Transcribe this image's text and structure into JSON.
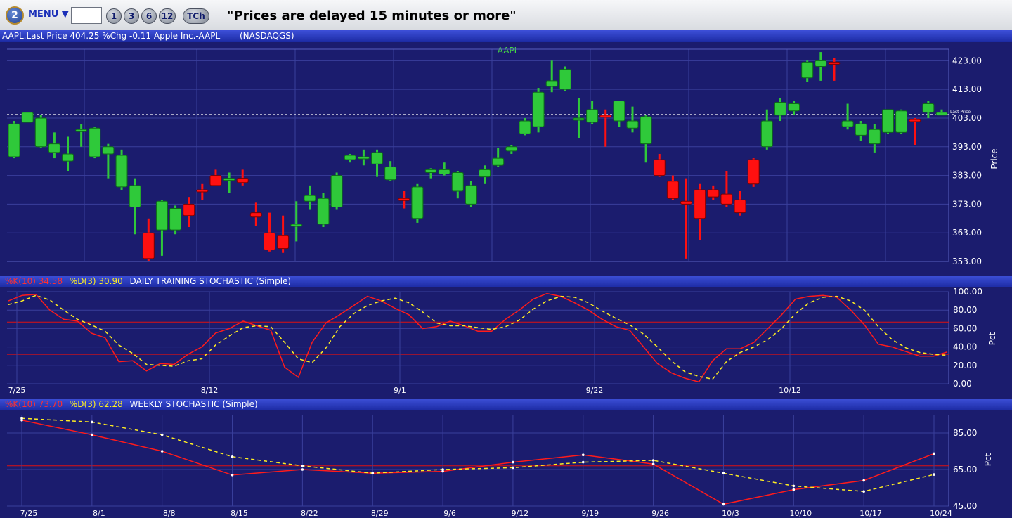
{
  "toolbar": {
    "menu_label": "MENU ▼",
    "symbol_value": "",
    "buttons": [
      "1",
      "3",
      "6",
      "12",
      "TCh"
    ],
    "notice": "\"Prices are delayed 15 minutes or more\""
  },
  "quote_bar": {
    "text": "AAPL.Last Price 404.25 %Chg -0.11  Apple Inc.-AAPL",
    "exchange": "(NASDAQGS)"
  },
  "colors": {
    "up": "#2fc93a",
    "down": "#ff1010",
    "k_line": "#ff1b1b",
    "d_line": "#ffee22",
    "grid": "#3a3f9c",
    "bg": "#1b1c6e"
  },
  "chart_data": [
    {
      "type": "candlestick",
      "title": "AAPL",
      "ylabel": "Price",
      "ylim": [
        353,
        427
      ],
      "yticks": [
        "423.00",
        "413.00",
        "403.00",
        "393.00",
        "383.00",
        "373.00",
        "363.00",
        "353.00"
      ],
      "last_price": 404.25,
      "last_label": "Last Price",
      "candles": [
        {
          "o": 389.5,
          "h": 402,
          "l": 389,
          "c": 401
        },
        {
          "o": 401.5,
          "h": 405,
          "l": 402,
          "c": 405
        },
        {
          "o": 393,
          "h": 404,
          "l": 392.5,
          "c": 403
        },
        {
          "o": 391,
          "h": 398,
          "l": 389,
          "c": 394
        },
        {
          "o": 388,
          "h": 396.5,
          "l": 384.5,
          "c": 390.5
        },
        {
          "o": 399,
          "h": 401,
          "l": 393,
          "c": 399
        },
        {
          "o": 389.5,
          "h": 400,
          "l": 389,
          "c": 399.5
        },
        {
          "o": 390.5,
          "h": 394,
          "l": 382,
          "c": 393
        },
        {
          "o": 379,
          "h": 392,
          "l": 378,
          "c": 390
        },
        {
          "o": 372,
          "h": 382,
          "l": 362.5,
          "c": 379.5
        },
        {
          "o": 363,
          "h": 368,
          "l": 353,
          "c": 354
        },
        {
          "o": 364,
          "h": 374.5,
          "l": 355,
          "c": 374
        },
        {
          "o": 364,
          "h": 372.5,
          "l": 362.5,
          "c": 371.5
        },
        {
          "o": 373,
          "h": 375.5,
          "l": 365,
          "c": 369
        },
        {
          "o": 378,
          "h": 380,
          "l": 374.5,
          "c": 377.5
        },
        {
          "o": 383,
          "h": 385,
          "l": 380,
          "c": 379.5
        },
        {
          "o": 382,
          "h": 384,
          "l": 377,
          "c": 382
        },
        {
          "o": 382,
          "h": 385,
          "l": 379.5,
          "c": 380.5
        },
        {
          "o": 370,
          "h": 373.5,
          "l": 365.5,
          "c": 368.5
        },
        {
          "o": 363,
          "h": 370,
          "l": 356.5,
          "c": 357
        },
        {
          "o": 362,
          "h": 369,
          "l": 356,
          "c": 357.5
        },
        {
          "o": 366,
          "h": 374,
          "l": 360,
          "c": 366
        },
        {
          "o": 374,
          "h": 379.5,
          "l": 371,
          "c": 376
        },
        {
          "o": 366,
          "h": 377,
          "l": 365,
          "c": 375
        },
        {
          "o": 372,
          "h": 384,
          "l": 371,
          "c": 383
        },
        {
          "o": 388.5,
          "h": 390.5,
          "l": 387.5,
          "c": 390
        },
        {
          "o": 389,
          "h": 392,
          "l": 386.5,
          "c": 389.5
        },
        {
          "o": 387,
          "h": 392,
          "l": 382.5,
          "c": 391
        },
        {
          "o": 381.5,
          "h": 388,
          "l": 381,
          "c": 386
        },
        {
          "o": 375,
          "h": 377.5,
          "l": 371.5,
          "c": 374.5
        },
        {
          "o": 368,
          "h": 380,
          "l": 366.5,
          "c": 379
        },
        {
          "o": 384,
          "h": 385.5,
          "l": 382,
          "c": 385
        },
        {
          "o": 383.5,
          "h": 387.5,
          "l": 383,
          "c": 385
        },
        {
          "o": 377.5,
          "h": 384.5,
          "l": 375,
          "c": 384
        },
        {
          "o": 373,
          "h": 381,
          "l": 372,
          "c": 379.5
        },
        {
          "o": 382.5,
          "h": 386.5,
          "l": 380,
          "c": 385
        },
        {
          "o": 386.5,
          "h": 392.5,
          "l": 386,
          "c": 389
        },
        {
          "o": 391.5,
          "h": 393.5,
          "l": 390.5,
          "c": 393
        },
        {
          "o": 397.5,
          "h": 403,
          "l": 397,
          "c": 402
        },
        {
          "o": 400,
          "h": 413.5,
          "l": 398,
          "c": 412
        },
        {
          "o": 414,
          "h": 423,
          "l": 412,
          "c": 416
        },
        {
          "o": 413,
          "h": 421,
          "l": 412.5,
          "c": 420
        },
        {
          "o": 403,
          "h": 410,
          "l": 396,
          "c": 403
        },
        {
          "o": 401.5,
          "h": 409,
          "l": 401,
          "c": 406
        },
        {
          "o": 404,
          "h": 406,
          "l": 393,
          "c": 403.5
        },
        {
          "o": 402,
          "h": 409,
          "l": 400,
          "c": 409
        },
        {
          "o": 399.5,
          "h": 407,
          "l": 398,
          "c": 402
        },
        {
          "o": 394,
          "h": 404,
          "l": 387.5,
          "c": 403.5
        },
        {
          "o": 388.5,
          "h": 390.5,
          "l": 382.5,
          "c": 383
        },
        {
          "o": 381,
          "h": 383,
          "l": 374.5,
          "c": 375
        },
        {
          "o": 374,
          "h": 382,
          "l": 354,
          "c": 373
        },
        {
          "o": 378,
          "h": 380,
          "l": 360.5,
          "c": 368
        },
        {
          "o": 378,
          "h": 379.5,
          "l": 374.5,
          "c": 375.5
        },
        {
          "o": 376.5,
          "h": 384.5,
          "l": 372,
          "c": 373
        },
        {
          "o": 374.5,
          "h": 377.5,
          "l": 369,
          "c": 370
        },
        {
          "o": 388.5,
          "h": 389,
          "l": 379,
          "c": 380
        },
        {
          "o": 393,
          "h": 406,
          "l": 392,
          "c": 402
        },
        {
          "o": 404,
          "h": 410,
          "l": 402,
          "c": 408.5
        },
        {
          "o": 405.5,
          "h": 409,
          "l": 404,
          "c": 408
        },
        {
          "o": 417,
          "h": 423,
          "l": 415.5,
          "c": 422.5
        },
        {
          "o": 421,
          "h": 426,
          "l": 416,
          "c": 423
        },
        {
          "o": 422.5,
          "h": 424,
          "l": 416,
          "c": 422
        },
        {
          "o": 400,
          "h": 408,
          "l": 399,
          "c": 402
        },
        {
          "o": 397,
          "h": 402,
          "l": 395,
          "c": 401
        },
        {
          "o": 394,
          "h": 401,
          "l": 391,
          "c": 399
        },
        {
          "o": 398,
          "h": 406,
          "l": 397.5,
          "c": 406
        },
        {
          "o": 398,
          "h": 406,
          "l": 397.5,
          "c": 405.5
        },
        {
          "o": 402.5,
          "h": 403,
          "l": 393.5,
          "c": 402
        },
        {
          "o": 405,
          "h": 409,
          "l": 403,
          "c": 408
        },
        {
          "o": 404,
          "h": 406,
          "l": 404,
          "c": 405
        }
      ]
    },
    {
      "type": "line",
      "title": "DAILY TRAINING STOCHASTIC (Simple)",
      "k_label": "%K(10) 34.58",
      "d_label": "%D(3) 30.90",
      "ylabel": "Pct",
      "ylim": [
        0,
        100
      ],
      "yticks": [
        "100.00",
        "80.00",
        "60.00",
        "40.00",
        "20.00",
        "0.00"
      ],
      "bands": [
        67,
        32
      ],
      "x_labels": [
        "7/25",
        "8/12",
        "9/1",
        "9/22",
        "10/12"
      ],
      "series": [
        {
          "name": "%K(10) 34.58",
          "values": [
            90,
            96,
            97,
            80,
            70,
            68,
            55,
            50,
            24,
            25,
            14,
            22,
            21,
            32,
            40,
            55,
            60,
            68,
            63,
            58,
            18,
            7,
            45,
            66,
            75,
            85,
            95,
            90,
            82,
            75,
            60,
            62,
            68,
            63,
            57,
            57,
            70,
            80,
            92,
            98,
            95,
            88,
            80,
            70,
            62,
            58,
            40,
            22,
            12,
            6,
            2,
            25,
            38,
            38,
            45,
            60,
            75,
            92,
            95,
            96,
            94,
            80,
            64,
            43,
            40,
            35,
            30,
            30,
            34.58
          ]
        },
        {
          "name": "%D(3) 30.90",
          "values": [
            86,
            90,
            96,
            91,
            80,
            70,
            64,
            57,
            42,
            33,
            21,
            20,
            19,
            25,
            27,
            42,
            52,
            61,
            63,
            62,
            45,
            27,
            23,
            39,
            62,
            76,
            85,
            90,
            93,
            88,
            78,
            66,
            63,
            63,
            61,
            59,
            62,
            69,
            81,
            90,
            95,
            94,
            88,
            79,
            71,
            64,
            54,
            40,
            25,
            13,
            8,
            5,
            24,
            34,
            40,
            48,
            60,
            76,
            88,
            94,
            95,
            90,
            80,
            62,
            48,
            39,
            34,
            32,
            30.9
          ]
        }
      ]
    },
    {
      "type": "line",
      "title": "WEEKLY STOCHASTIC (Simple)",
      "k_label": "%K(10) 73.70",
      "d_label": "%D(3) 62.28",
      "ylabel": "Pct",
      "ylim": [
        45,
        95
      ],
      "yticks": [
        "85.00",
        "65.00",
        "45.00"
      ],
      "band": 67,
      "x_labels": [
        "7/25",
        "8/1",
        "8/8",
        "8/15",
        "8/22",
        "8/29",
        "9/6",
        "9/12",
        "9/19",
        "9/26",
        "10/3",
        "10/10",
        "10/17",
        "10/24"
      ],
      "series": [
        {
          "name": "%K(10) 73.70",
          "values": [
            92,
            84,
            75,
            62,
            65,
            63,
            64,
            69,
            73,
            68,
            46,
            54,
            59,
            73.7
          ]
        },
        {
          "name": "%D(3) 62.28",
          "values": [
            93,
            91,
            84,
            72,
            67,
            63,
            65,
            66,
            69,
            70,
            63,
            56,
            53,
            62.28
          ]
        }
      ]
    }
  ]
}
